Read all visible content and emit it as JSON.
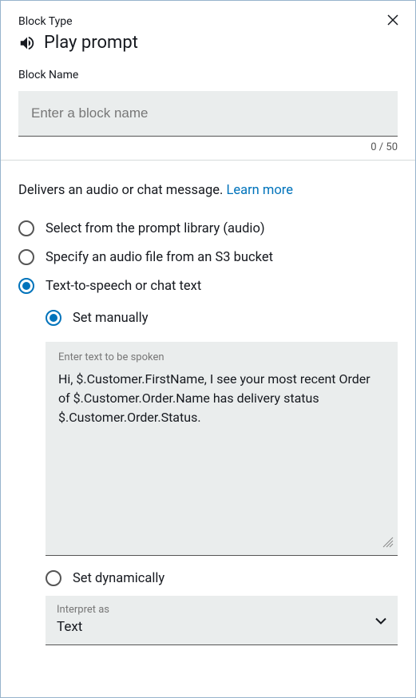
{
  "header": {
    "block_type_label": "Block Type",
    "title": "Play prompt"
  },
  "block_name": {
    "label": "Block Name",
    "placeholder": "Enter a block name",
    "value": "",
    "counter": "0 / 50"
  },
  "description": {
    "text": "Delivers an audio or chat message. ",
    "link": "Learn more"
  },
  "options": {
    "prompt_library": "Select from the prompt library (audio)",
    "s3_bucket": "Specify an audio file from an S3 bucket",
    "tts": "Text-to-speech or chat text"
  },
  "tts_sub": {
    "set_manually": "Set manually",
    "set_dynamically": "Set dynamically",
    "textarea_label": "Enter text to be spoken",
    "textarea_value": "Hi, $.Customer.FirstName, I see your most recent Order of $.Customer.Order.Name has delivery status $.Customer.Order.Status."
  },
  "interpret": {
    "label": "Interpret as",
    "value": "Text"
  }
}
